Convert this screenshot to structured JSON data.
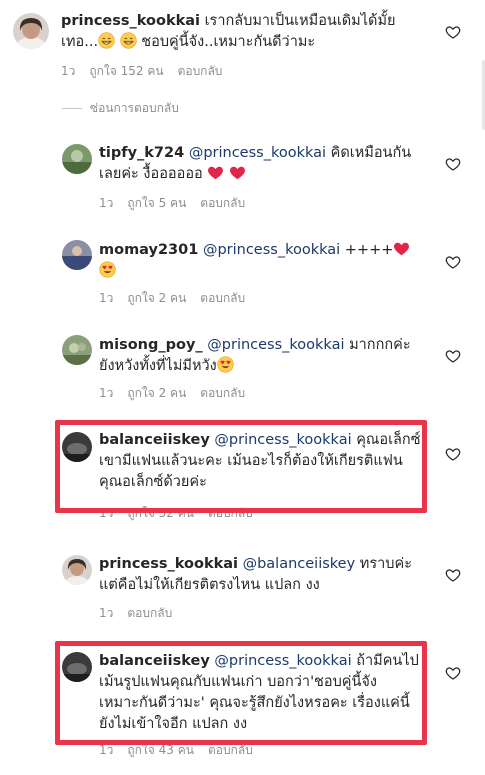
{
  "hide_replies_label": "ซ่อนการตอบกลับ",
  "highlight_color": "#e8354a",
  "comments": [
    {
      "username": "princess_kookkai",
      "text_1": "เรากลับมาเป็นเหมือนเดิมได้มั้ย",
      "text_2": "เทอ...",
      "text_3": " ชอบคู่นี้จัง..เหมาะกันดีว่ามะ",
      "time": "1ว",
      "likes": "ถูกใจ 152 คน",
      "reply": "ตอบกลับ"
    },
    {
      "username": "tipfy_k724",
      "mention": "@princess_kookkai",
      "text_1": " คิดเหมือนกัน",
      "text_2": "เลยค่ะ งื้ออออออ ",
      "time": "1ว",
      "likes": "ถูกใจ 5 คน",
      "reply": "ตอบกลับ"
    },
    {
      "username": "momay2301",
      "mention": "@princess_kookkai",
      "text_1": " ++++",
      "time": "1ว",
      "likes": "ถูกใจ 2 คน",
      "reply": "ตอบกลับ"
    },
    {
      "username": "misong_poy_",
      "mention": "@princess_kookkai",
      "text_1": " มากกกค่ะ",
      "text_2": "ยังหวังทั้งที่ไม่มีหวัง",
      "time": "1ว",
      "likes": "ถูกใจ 2 คน",
      "reply": "ตอบกลับ"
    },
    {
      "username": "balanceiiskey",
      "mention": "@princess_kookkai",
      "text_1": " คุณอเล็กซ์",
      "text_2": "เขามีแฟนแล้วนะคะ เม้นอะไรก็ต้องให้เกียรติแฟน",
      "text_3": "คุณอเล็กซ์ด้วยค่ะ",
      "time": "1ว",
      "likes": "ถูกใจ 32 คน",
      "reply": "ตอบกลับ"
    },
    {
      "username": "princess_kookkai",
      "mention": "@balanceiiskey",
      "text_1": " ทราบค่ะ",
      "text_2": "แต่คือไม่ให้เกียรติตรงไหน แปลก งง",
      "time": "1ว",
      "reply": "ตอบกลับ"
    },
    {
      "username": "balanceiiskey",
      "mention": "@princess_kookkai",
      "text_1": " ถ้ามีคนไป",
      "text_2": "เม้นรูปแฟนคุณกับแฟนเก่า บอกว่า'ชอบคู่นี้จัง",
      "text_3": "เหมาะกันดีว่ามะ' คุณจะรู้สึกยังไงหรอคะ เรื่องแค่นี้",
      "text_4": "ยังไม่เข้าใจอีก แปลก งง",
      "time": "1ว",
      "likes": "ถูกใจ 43 คน",
      "reply": "ตอบกลับ"
    }
  ]
}
